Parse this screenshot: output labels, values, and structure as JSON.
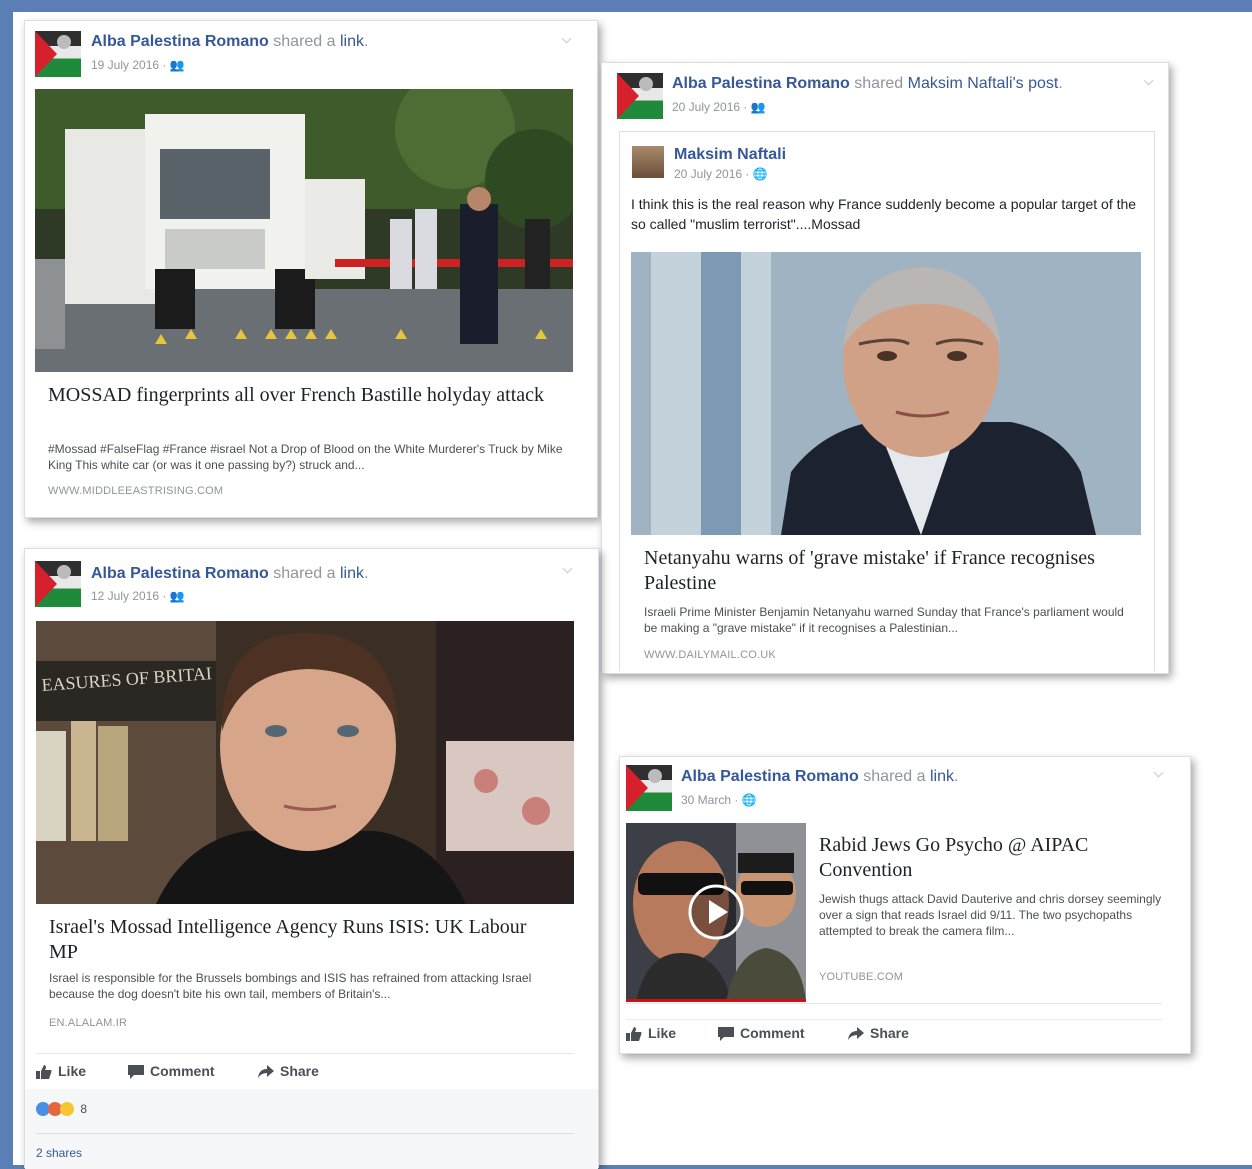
{
  "posts": [
    {
      "author": "Alba Palestina Romano",
      "verb": "shared a",
      "object": "link",
      "suffix": ".",
      "date": "19 July 2016",
      "link_title": "MOSSAD fingerprints all over French Bastille holyday attack",
      "link_desc": "#Mossad #FalseFlag #France #israel Not a Drop of Blood on the White Murderer's Truck by Mike King This white car (or was it one passing by?) struck and...",
      "domain": "WWW.MIDDLEEASTRISING.COM"
    },
    {
      "author": "Alba Palestina Romano",
      "verb": "shared",
      "object": "Maksim Naftali's",
      "object2": "post",
      "suffix": ".",
      "date": "20 July 2016",
      "inner_author": "Maksim Naftali",
      "inner_date": "20 July 2016",
      "inner_text": "I think this is the real reason why France suddenly become a popular target of the so called \"muslim terrorist\"....Mossad",
      "link_title": "Netanyahu warns of 'grave mistake' if France recognises Palestine",
      "link_desc": "Israeli Prime Minister Benjamin Netanyahu warned Sunday that France's parliament would be making a \"grave mistake\" if it recognises a Palestinian...",
      "domain": "WWW.DAILYMAIL.CO.UK"
    },
    {
      "author": "Alba Palestina Romano",
      "verb": "shared a",
      "object": "link",
      "suffix": ".",
      "date": "12 July 2016",
      "link_title": "Israel's Mossad Intelligence Agency Runs ISIS: UK Labour MP",
      "link_desc": "Israel is responsible for the Brussels bombings and ISIS has refrained from attacking Israel because the dog doesn't bite his own tail, members of Britain's...",
      "domain": "EN.ALALAM.IR",
      "reaction_count": "8",
      "shares": "2 shares"
    },
    {
      "author": "Alba Palestina Romano",
      "verb": "shared a",
      "object": "link",
      "suffix": ".",
      "date": "30 March",
      "link_title": "Rabid Jews Go Psycho @ AIPAC Convention",
      "link_desc": "Jewish thugs attack David Dauterive and chris dorsey seemingly over a sign that reads Israel did 9/11. The two psychopaths attempted to break the camera film...",
      "domain": "YOUTUBE.COM"
    }
  ],
  "actions": {
    "like": "Like",
    "comment": "Comment",
    "share": "Share"
  },
  "image_text": {
    "book_spine": "EASURES OF BRITAI"
  },
  "colors": {
    "frame": "#5b7fb5",
    "link_blue": "#365899",
    "meta_gray": "#90949c"
  }
}
